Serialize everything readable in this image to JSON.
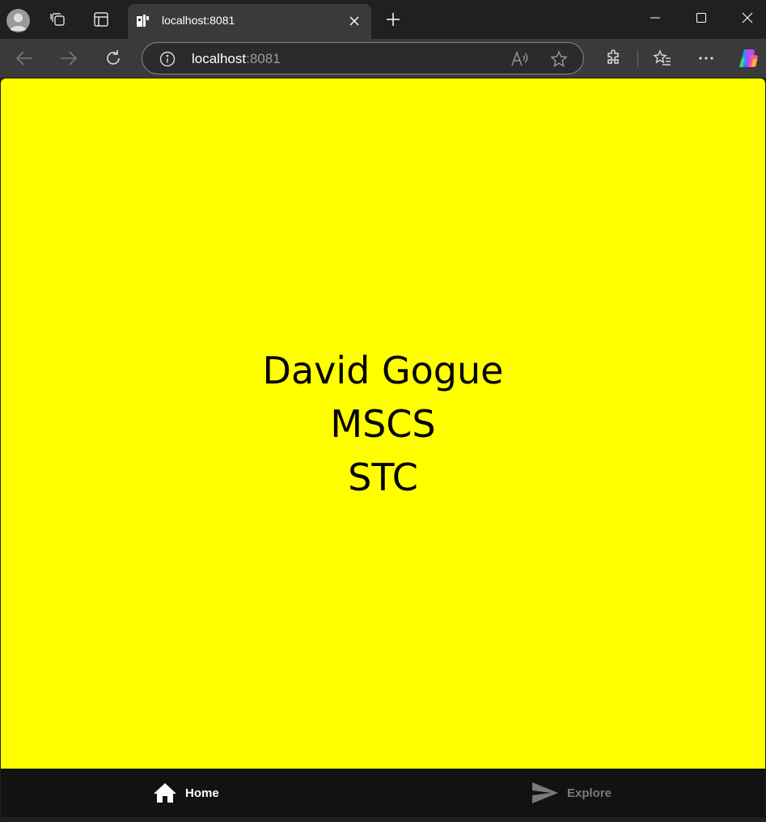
{
  "browser": {
    "tab_title": "localhost:8081",
    "url_host": "localhost",
    "url_port": ":8081"
  },
  "page": {
    "background": "#ffff00",
    "lines": [
      "David Gogue",
      "MSCS",
      "STC"
    ]
  },
  "bottom_nav": {
    "items": [
      {
        "label": "Home",
        "icon": "home-icon",
        "active": true,
        "color": "#ffffff"
      },
      {
        "label": "Explore",
        "icon": "send-icon",
        "active": false,
        "color": "#7a7a7a"
      }
    ]
  }
}
